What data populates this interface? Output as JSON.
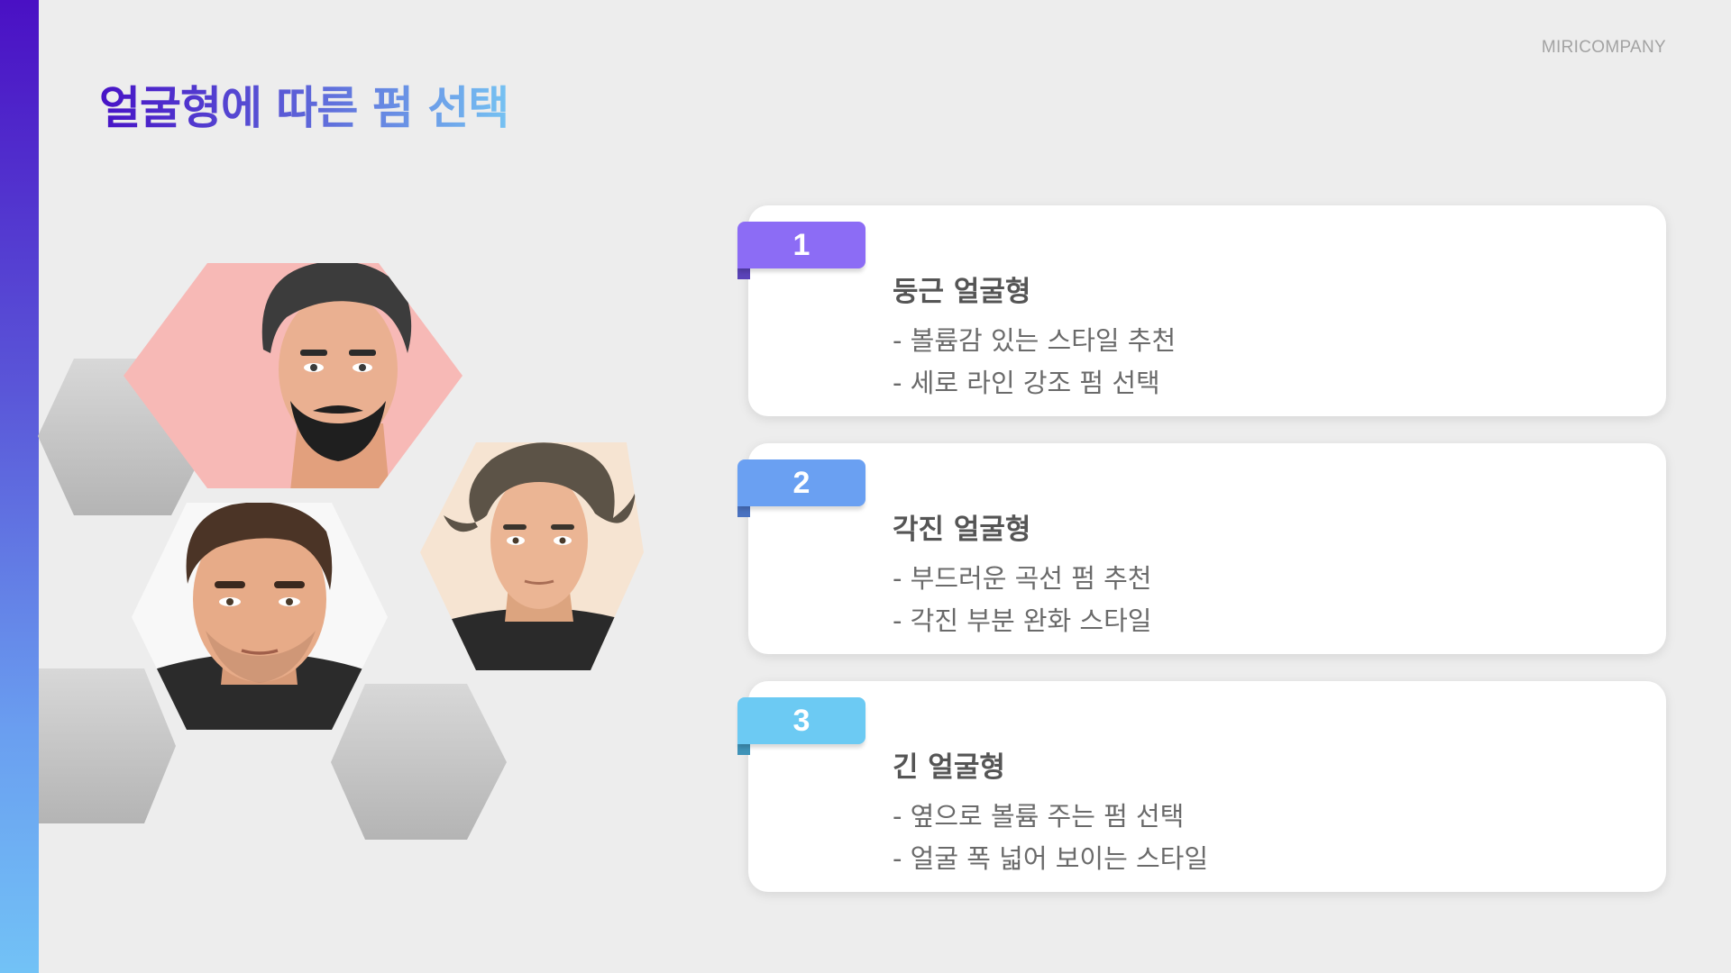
{
  "brand": "MIRICOMPANY",
  "title": "얼굴형에 따른 펌 선택",
  "colors": {
    "sidebar_top": "#4a10c4",
    "sidebar_bottom": "#72c2f6",
    "title_gradient_start": "#4712c6",
    "title_gradient_end": "#76c2f2",
    "ribbon_1": "#8c6cf5",
    "ribbon_2": "#6aa0f2",
    "ribbon_3": "#6ccaf3",
    "hex_pink": "#f7b9b6",
    "hex_cream": "#f6e4d2",
    "hex_white": "#f8f8f8",
    "hex_gray": "#c4c4c4"
  },
  "cards": [
    {
      "number": "1",
      "title": "둥근 얼굴형",
      "lines": [
        "- 볼륨감 있는 스타일 추천",
        "- 세로 라인 강조 펌 선택"
      ]
    },
    {
      "number": "2",
      "title": "각진 얼굴형",
      "lines": [
        "- 부드러운 곡선 펌 추천",
        "- 각진 부분 완화 스타일"
      ]
    },
    {
      "number": "3",
      "title": "긴 얼굴형",
      "lines": [
        "- 옆으로 볼륨 주는 펌 선택",
        "- 얼굴 폭 넓어 보이는 스타일"
      ]
    }
  ],
  "portraits": [
    {
      "name": "portrait-bearded-man",
      "icon": "man-face-icon"
    },
    {
      "name": "portrait-wavy-hair-man",
      "icon": "man-face-icon"
    },
    {
      "name": "portrait-stubble-man",
      "icon": "man-face-icon"
    }
  ]
}
